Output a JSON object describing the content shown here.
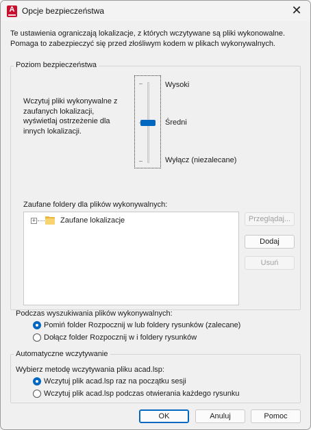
{
  "window": {
    "title": "Opcje bezpieczeństwa",
    "app_icon_letter": "A",
    "close_glyph": "✕"
  },
  "intro": {
    "line1": "Te ustawienia ograniczają lokalizacje, z których wczytywane są pliki wykonowalne.",
    "line2": "Pomaga to zabezpieczyć się przed złośliwym kodem w plikach wykonywalnych."
  },
  "security_level": {
    "legend": "Poziom bezpieczeństwa",
    "description_lines": [
      "Wczytuj pliki wykonywalne z",
      "zaufanych lokalizacji,",
      "wyświetlaj ostrzeżenie dla",
      "innych lokalizacji."
    ],
    "levels": [
      "Wysoki",
      "Średni",
      "Wyłącz (niezalecane)"
    ],
    "selected_level": "Średni",
    "trusted_folders_label": "Zaufane foldery dla plików wykonywalnych:",
    "tree": {
      "expand_glyph": "+",
      "items": [
        "Zaufane lokalizacje"
      ]
    },
    "buttons": {
      "browse": "Przeglądaj...",
      "add": "Dodaj",
      "remove": "Usuń"
    }
  },
  "search": {
    "label": "Podczas wyszukiwania plików wykonywalnych:",
    "options": [
      {
        "label": "Pomiń folder Rozpocznij w lub foldery rysunków (zalecane)",
        "checked": true
      },
      {
        "label": "Dołącz folder Rozpocznij w i foldery rysunków",
        "checked": false
      }
    ]
  },
  "auto_load": {
    "legend": "Automatyczne wczytywanie",
    "label": "Wybierz metodę wczytywania pliku acad.lsp:",
    "options": [
      {
        "label": "Wczytuj plik acad.lsp raz na początku sesji",
        "checked": true
      },
      {
        "label": "Wczytuj plik acad.lsp podczas otwierania każdego rysunku",
        "checked": false
      }
    ]
  },
  "footer": {
    "ok": "OK",
    "cancel": "Anuluj",
    "help": "Pomoc"
  },
  "colors": {
    "accent": "#0067c0",
    "app_icon": "#c8102e",
    "folder": "#f7d470"
  }
}
